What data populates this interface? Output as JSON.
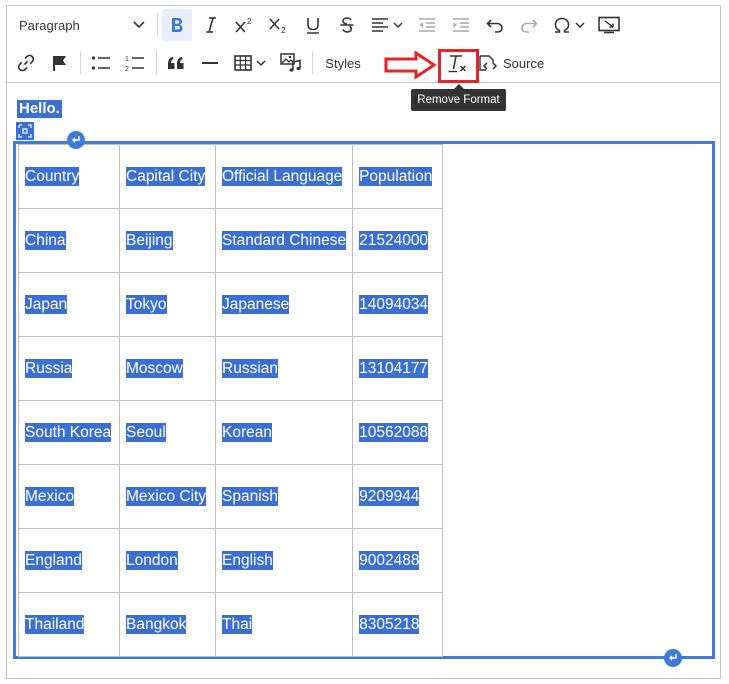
{
  "toolbar": {
    "heading_dropdown": "Paragraph",
    "styles_label": "Styles",
    "source_label": "Source",
    "tooltip": "Remove Format"
  },
  "editor": {
    "hello_text": "Hello.",
    "table": {
      "headers": [
        "Country",
        "Capital City",
        "Official Language",
        "Population"
      ],
      "rows": [
        [
          "China",
          "Beijing",
          "Standard Chinese",
          "21524000"
        ],
        [
          "Japan",
          "Tokyo",
          "Japanese",
          "14094034"
        ],
        [
          "Russia",
          "Moscow",
          "Russian",
          "13104177"
        ],
        [
          "South Korea",
          "Seoul",
          "Korean",
          "10562088"
        ],
        [
          "Mexico",
          "Mexico City",
          "Spanish",
          "9209944"
        ],
        [
          "England",
          "London",
          "English",
          "9002488"
        ],
        [
          "Thailand",
          "Bangkok",
          "Thai",
          "8305218"
        ]
      ]
    }
  },
  "colors": {
    "selection": "#3b6fd1",
    "widget_border": "#3f7ad6",
    "annotation_red": "#e8222a",
    "bold_active_bg": "#e8eefb"
  }
}
